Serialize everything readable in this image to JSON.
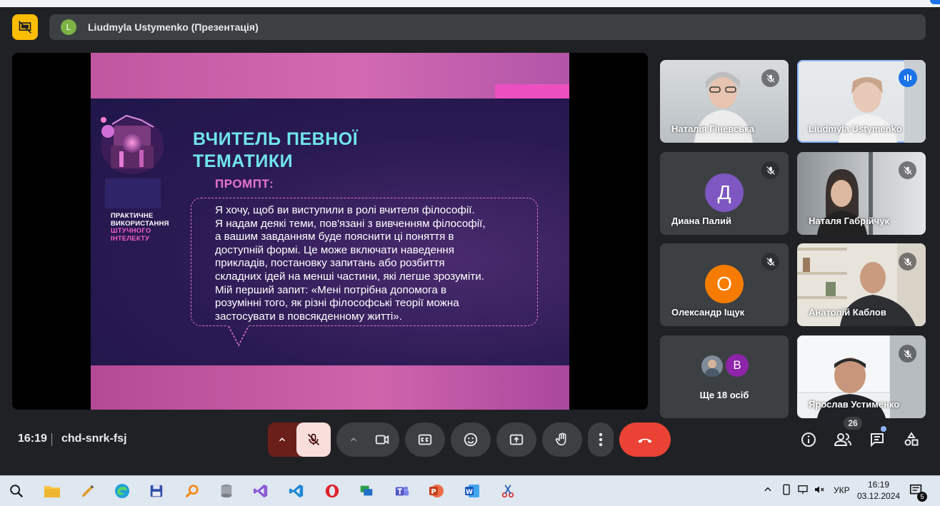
{
  "header": {
    "presenter_initial": "L",
    "presenter_title": "Liudmyla Ustymenko (Презентація)"
  },
  "slide": {
    "side_label_1": "ПРАКТИЧНЕ",
    "side_label_2": "ВИКОРИСТАННЯ",
    "side_label_3": "ШТУЧНОГО",
    "side_label_4": "ІНТЕЛЕКТУ",
    "heading_line1": "ВЧИТЕЛЬ ПЕВНОЇ",
    "heading_line2": "ТЕМАТИКИ",
    "prompt_label": "ПРОМПТ:",
    "prompt_lines": [
      "Я хочу, щоб ви виступили в ролі вчителя філософії.",
      "Я надам деякі теми, пов'язані з вивченням філософії,",
      "а вашим завданням буде пояснити ці поняття в",
      "доступній формі. Це може включати наведення",
      "прикладів, постановку запитань або розбиття",
      "складних ідей на менші частини, які легше зрозуміти.",
      "Мій перший запит: «Мені потрібна допомога в",
      "розумінні того, як різні філософські теорії можна",
      "застосувати в повсякденному житті»."
    ]
  },
  "participants": [
    {
      "name": "Наталія Гіневська"
    },
    {
      "name": "Liudmyla Ustymenko"
    },
    {
      "name": "Диана Палий",
      "initial": "Д"
    },
    {
      "name": "Наталя Габрійчук"
    },
    {
      "name": "Олександр Іщук",
      "initial": "О"
    },
    {
      "name": "Анатолій Каблов"
    },
    {
      "name": "Ще 18 осіб",
      "initial": "В"
    },
    {
      "name": "Ярослав Устименко"
    }
  ],
  "bottom": {
    "time": "16:19",
    "meeting_code": "chd-snrk-fsj",
    "people_count": "26"
  },
  "taskbar": {
    "lang": "УКР",
    "time": "16:19",
    "date": "03.12.2024",
    "notif_count": "5"
  },
  "colors": {
    "accent_blue": "#8ab4f8",
    "end_call_red": "#ea4335",
    "mic_off_bg": "#f9dedc",
    "presentation_yellow": "#fbbc04"
  }
}
